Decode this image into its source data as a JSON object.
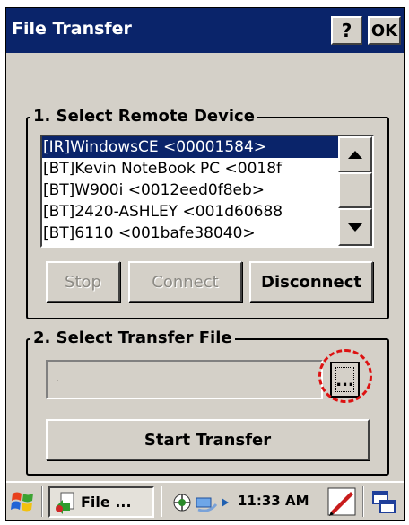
{
  "window": {
    "title": "File Transfer",
    "help_label": "?",
    "ok_label": "OK"
  },
  "remote_device": {
    "group_title": "1. Select Remote Device",
    "devices": [
      "[IR]WindowsCE <00001584>",
      "[BT]Kevin NoteBook PC <0018f",
      "[BT]W900i <0012eed0f8eb>",
      "[BT]2420-ASHLEY <001d60688",
      "[BT]6110 <001bafe38040>"
    ],
    "selected_index": 0,
    "stop_label": "Stop",
    "connect_label": "Connect",
    "disconnect_label": "Disconnect"
  },
  "transfer_file": {
    "group_title": "2. Select Transfer File",
    "file_value": "",
    "browse_label": "...",
    "start_label": "Start Transfer"
  },
  "taskbar": {
    "start_icon": "windows-flag-icon",
    "task_label": "File ...",
    "clock": "11:33 AM"
  },
  "colors": {
    "titlebar": "#0a246a",
    "selection": "#0a246a",
    "dialog": "#d4d0c8",
    "annotation": "#dd1111"
  }
}
